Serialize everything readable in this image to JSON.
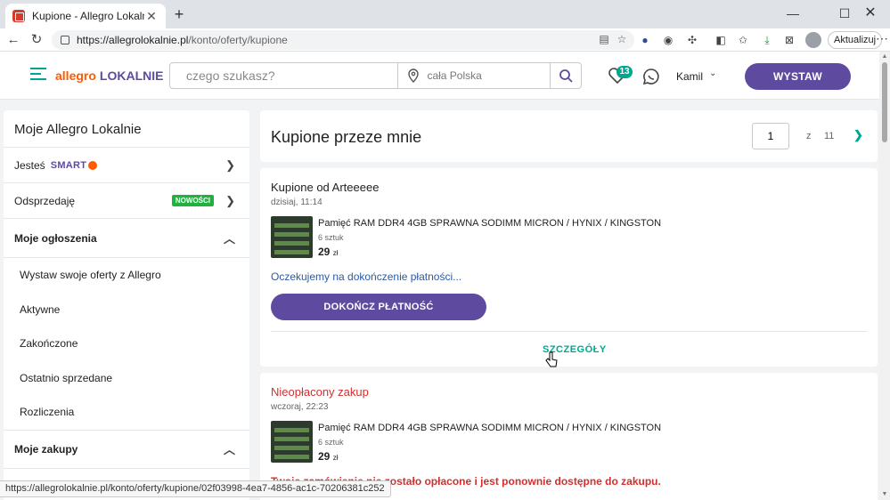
{
  "browser": {
    "tab_title": "Kupione - Allegro Lokalnie",
    "url_host": "https://allegrolokalnie.pl",
    "url_path": "/konto/oferty/kupione",
    "update_label": "Aktualizuj",
    "status_url": "https://allegrolokalnie.pl/konto/oferty/kupione/02f03998-4ea7-4856-ac1c-70206381c252"
  },
  "header": {
    "logo_part1": "allegro",
    "logo_part2": "LOKALNIE",
    "search_placeholder": "czego szukasz?",
    "location_placeholder": "cała Polska",
    "favorites_count": "13",
    "user_name": "Kamil",
    "post_label": "WYSTAW"
  },
  "sidebar": {
    "title": "Moje Allegro Lokalnie",
    "jestes": "Jesteś",
    "smart": "SMART",
    "odsprzedaje": "Odsprzedaję",
    "new_badge": "NOWOŚCI",
    "moje_ogloszenia": "Moje ogłoszenia",
    "sub_items": [
      "Wystaw swoje oferty z Allegro",
      "Aktywne",
      "Zakończone",
      "Ostatnio sprzedane",
      "Rozliczenia"
    ],
    "moje_zakupy": "Moje zakupy"
  },
  "main": {
    "title": "Kupione przeze mnie",
    "page_current": "1",
    "page_of": "z",
    "page_total": "11"
  },
  "orders": [
    {
      "title": "Kupione od Arteeeee",
      "date": "dzisiaj, 11:14",
      "item_name": "Pamięć RAM DDR4 4GB SPRAWNA SODIMM MICRON / HYNIX / KINGSTON",
      "qty": "6 sztuk",
      "price": "29",
      "currency": "zł",
      "status": "Oczekujemy na dokończenie płatności...",
      "pay_label": "DOKOŃCZ PŁATNOŚĆ",
      "details_label": "SZCZEGÓŁY"
    },
    {
      "title": "Nieopłacony zakup",
      "date": "wczoraj, 22:23",
      "item_name": "Pamięć RAM DDR4 4GB SPRAWNA SODIMM MICRON / HYNIX / KINGSTON",
      "qty": "6 sztuk",
      "price": "29",
      "currency": "zł",
      "status": "Twoje zamówienie nie zostało opłacone i jest ponownie dostępne do zakupu."
    }
  ]
}
